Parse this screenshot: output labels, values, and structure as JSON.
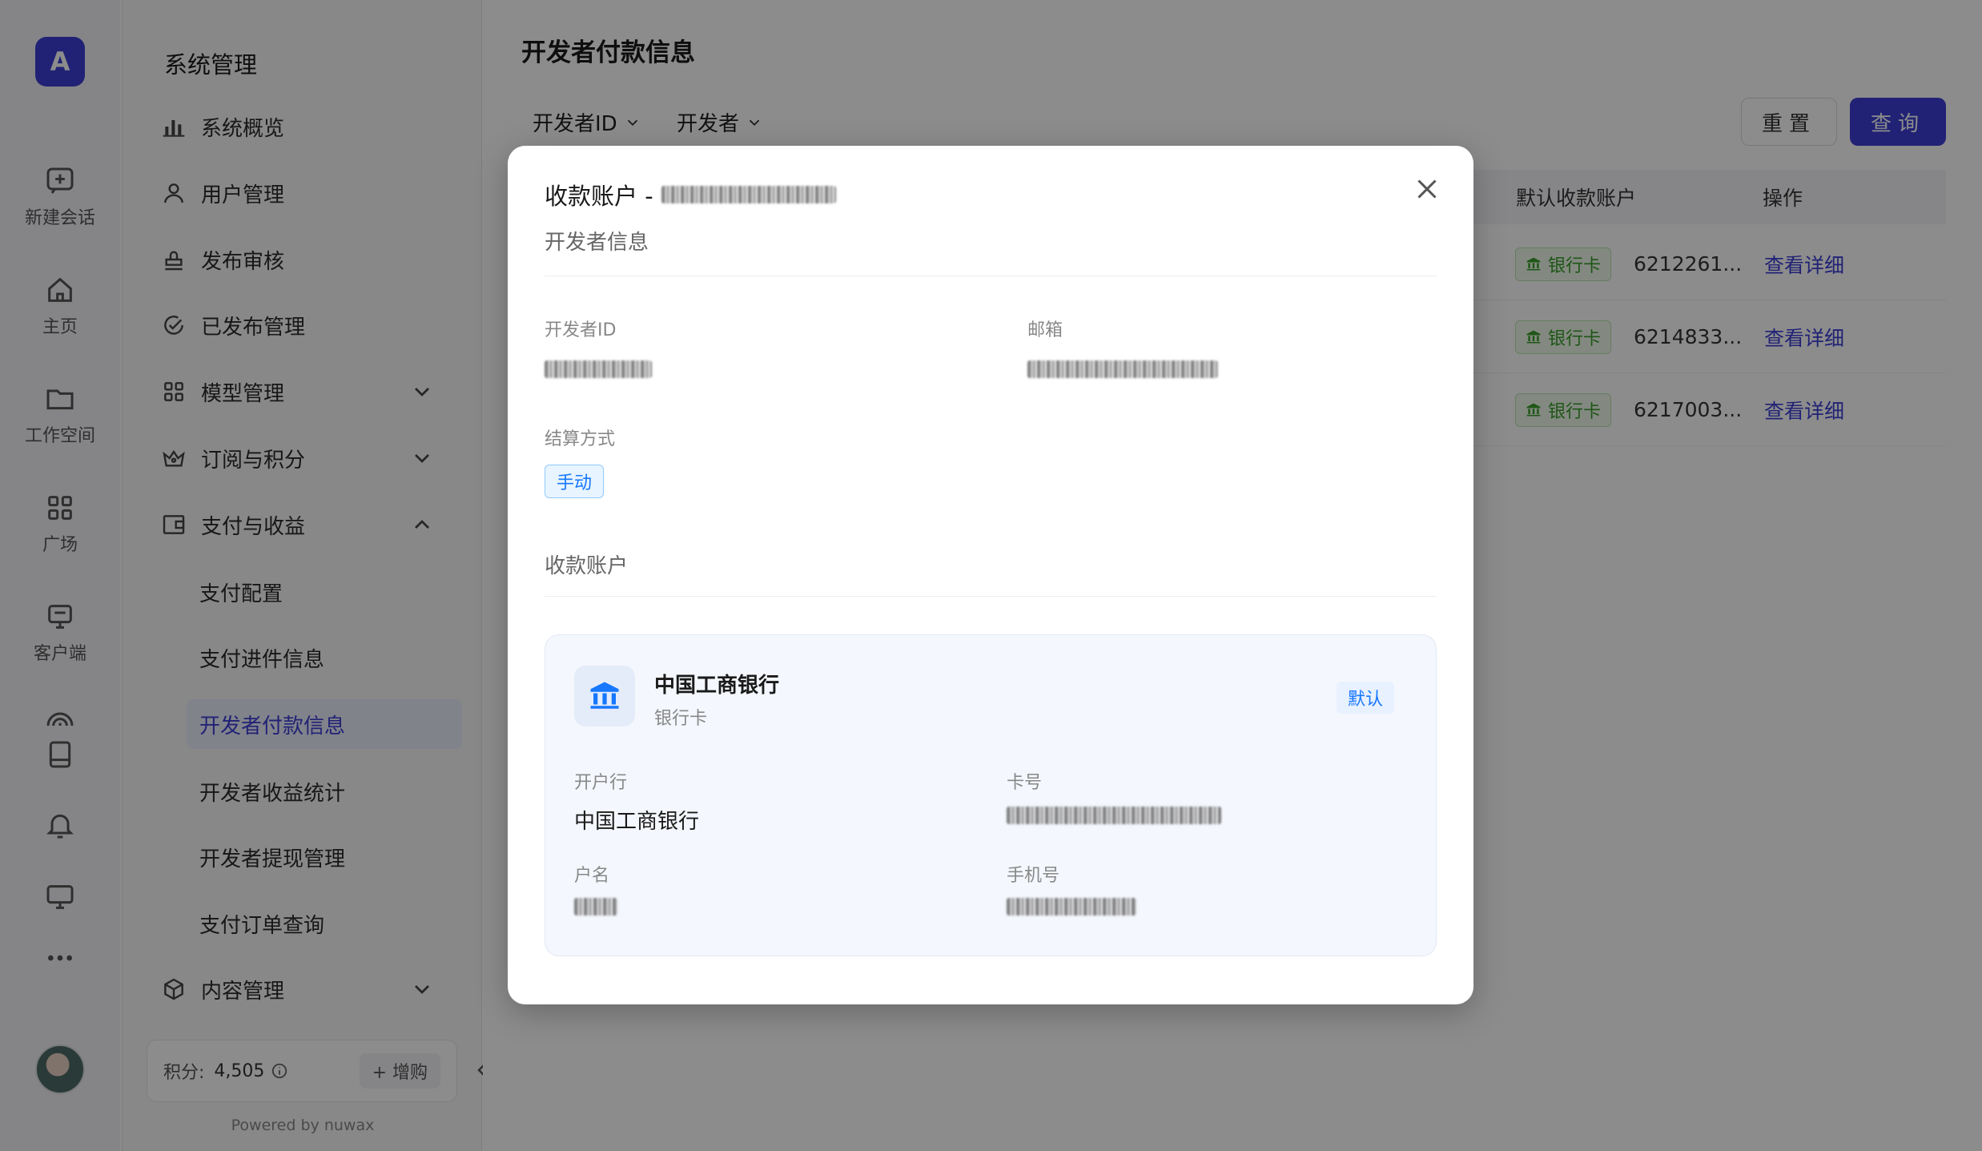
{
  "rail": {
    "logo": "A",
    "items": [
      {
        "label": "新建会话",
        "icon": "chat-plus-icon"
      },
      {
        "label": "主页",
        "icon": "home-icon"
      },
      {
        "label": "工作空间",
        "icon": "folder-icon"
      },
      {
        "label": "广场",
        "icon": "grid-icon"
      },
      {
        "label": "客户端",
        "icon": "monitor-icon"
      }
    ]
  },
  "nav": {
    "title": "系统管理",
    "items": [
      {
        "label": "系统概览",
        "icon": "bar-chart-icon"
      },
      {
        "label": "用户管理",
        "icon": "user-icon"
      },
      {
        "label": "发布审核",
        "icon": "stamp-icon"
      },
      {
        "label": "已发布管理",
        "icon": "check-circle-icon"
      },
      {
        "label": "模型管理",
        "icon": "apps-icon"
      },
      {
        "label": "订阅与积分",
        "icon": "crown-icon"
      },
      {
        "label": "支付与收益",
        "icon": "wallet-icon"
      },
      {
        "label": "内容管理",
        "icon": "cube-icon"
      }
    ],
    "sub_items": [
      "支付配置",
      "支付进件信息",
      "开发者付款信息",
      "开发者收益统计",
      "开发者提现管理",
      "支付订单查询"
    ],
    "points_label": "积分:",
    "points_value": "4,505",
    "buy_label": "+ 增购",
    "powered": "Powered by nuwax"
  },
  "main": {
    "title": "开发者付款信息",
    "filters": [
      "开发者ID",
      "开发者"
    ],
    "reset_label": "重置",
    "query_label": "查询",
    "columns": [
      "默认收款账户",
      "操作"
    ],
    "rows": [
      {
        "tag": "银行卡",
        "account": "6212261...",
        "action": "查看详细"
      },
      {
        "tag": "银行卡",
        "account": "6214833...",
        "action": "查看详细"
      },
      {
        "tag": "银行卡",
        "account": "6217003...",
        "action": "查看详细"
      }
    ]
  },
  "modal": {
    "title": "收款账户 -",
    "section_dev": "开发者信息",
    "dev_id_label": "开发者ID",
    "email_label": "邮箱",
    "settle_label": "结算方式",
    "settle_value": "手动",
    "section_account": "收款账户",
    "bank": {
      "name": "中国工商银行",
      "type": "银行卡",
      "default_tag": "默认",
      "branch_label": "开户行",
      "branch_value": "中国工商银行",
      "card_label": "卡号",
      "holder_label": "户名",
      "phone_label": "手机号"
    }
  },
  "colors": {
    "accent": "#3d3fd6",
    "green": "#3a9d2a",
    "blue": "#1677ff"
  }
}
